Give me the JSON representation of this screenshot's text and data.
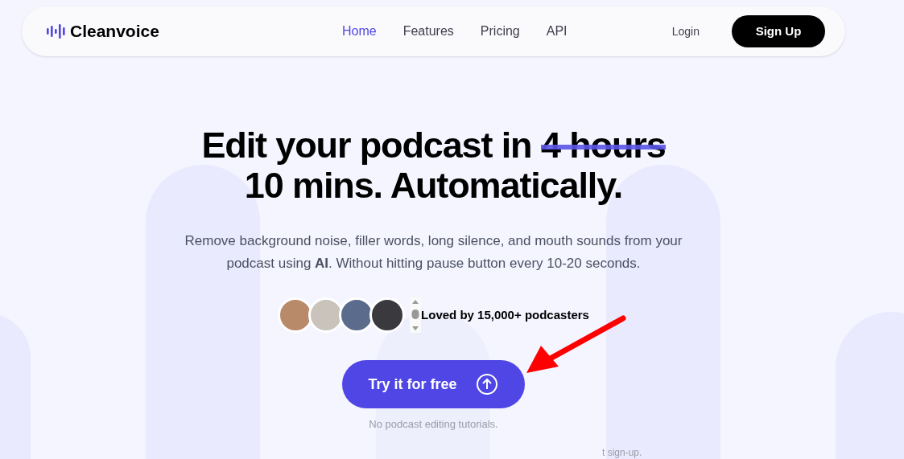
{
  "nav": {
    "logo": "Cleanvoice",
    "links": [
      {
        "label": "Home",
        "selected": true
      },
      {
        "label": "Features",
        "selected": false
      },
      {
        "label": "Pricing",
        "selected": false
      },
      {
        "label": "API",
        "selected": false
      }
    ],
    "login": "Login",
    "signup": "Sign Up"
  },
  "hero": {
    "title_start": "Edit your podcast in",
    "title_struck": "4 hours",
    "title_end": "10 mins. Automatically.",
    "subtitle": "Remove background noise, filler words, long silence, and mouth sounds from your podcast using **AI**. Without hitting pause button every 10-20 seconds.",
    "social_proof": "Loved by 15,000+ podcasters",
    "cta": "Try it for free",
    "note": "No podcast editing tutorials.",
    "cut_note": "t sign-up."
  }
}
